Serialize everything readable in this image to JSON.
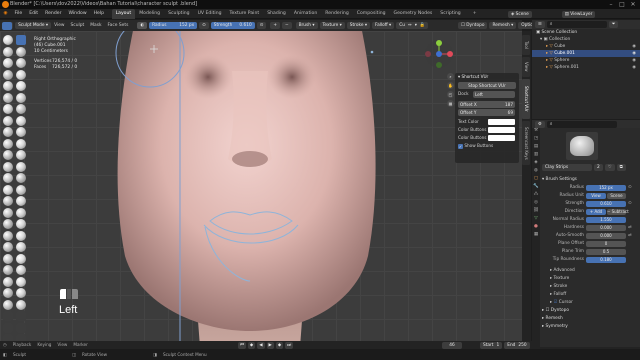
{
  "window": {
    "title": "Blender* [C:\\Users\\dov2022\\Videos\\Bahan Tutorial\\character sculpt .blend]",
    "controls": [
      "–",
      "□",
      "✕"
    ]
  },
  "menu": {
    "items": [
      "File",
      "Edit",
      "Render",
      "Window",
      "Help"
    ],
    "workspaces": [
      "Layout",
      "Modeling",
      "Sculpting",
      "UV Editing",
      "Texture Paint",
      "Shading",
      "Animation",
      "Rendering",
      "Compositing",
      "Geometry Nodes",
      "Scripting"
    ],
    "active_workspace": "Layout",
    "scene_label": "Scene",
    "view_layer_label": "ViewLayer"
  },
  "viewport_header": {
    "mode": "Sculpt Mode",
    "menus": [
      "View",
      "Sculpt",
      "Mask",
      "Face Sets"
    ],
    "radius_label": "Radius",
    "radius_value": "152 px",
    "strength_label": "Strength",
    "strength_value": "0.610",
    "right_menus": [
      "Brush",
      "Texture",
      "Stroke",
      "Falloff",
      "Cursor"
    ]
  },
  "viewport_info": {
    "view_name": "Right Orthographic",
    "object": "(46) Cube.001",
    "scale": "10 Centimeters",
    "vertices_label": "Vertices",
    "vertices_value": "726,574 / 0",
    "faces_label": "Faces",
    "faces_value": "726,572 / 0"
  },
  "viewport_header2": {
    "options": [
      "Dyntopo",
      "Remesh",
      "Options"
    ]
  },
  "screencast": {
    "label": "Left"
  },
  "npanel": {
    "title": "Shortcut VUr",
    "stop_button": "Stop Shortcut VUr",
    "dock_label": "Dock",
    "dock_value": "Left",
    "offset_x_label": "Offset X",
    "offset_x_value": "187",
    "offset_y_label": "Offset Y",
    "offset_y_value": "69",
    "text_color_label": "Text Color",
    "color_buttons_label": "Color Buttons",
    "color_buttons2_label": "Color Buttons",
    "show_buttons_label": "Show Buttons",
    "side_tabs": [
      "Tool",
      "View",
      "Shortcut VUr",
      "Screencast Keys"
    ]
  },
  "outliner": {
    "title": "Scene Collection",
    "rows": [
      {
        "label": "Collection",
        "selected": false
      },
      {
        "label": "Cube",
        "selected": false
      },
      {
        "label": "Cube.001",
        "selected": true
      },
      {
        "label": "Sphere",
        "selected": false
      },
      {
        "label": "Sphere.001",
        "selected": false
      }
    ]
  },
  "properties": {
    "brush_name": "Clay Strips",
    "brush_users": "2",
    "brush_settings": "Brush Settings",
    "radius_label": "Radius",
    "radius_value": "152 px",
    "radius_unit_label": "Radius Unit",
    "radius_unit_view": "View",
    "radius_unit_scene": "Scene",
    "strength_label": "Strength",
    "strength_value": "0.610",
    "direction_label": "Direction",
    "direction_add": "Add",
    "direction_subtract": "Subtract",
    "normal_radius_label": "Normal Radius",
    "normal_radius_value": "1.550",
    "hardness_label": "Hardness",
    "hardness_value": "0.000",
    "autosmooth_label": "Auto-Smooth",
    "autosmooth_value": "0.000",
    "plane_offset_label": "Plane Offset",
    "plane_offset_value": "0",
    "plane_trim_label": "Plane Trim",
    "plane_trim_value": "0.5",
    "tip_roundness_label": "Tip Roundness",
    "tip_roundness_value": "0.180",
    "sections": [
      "Advanced",
      "Texture",
      "Stroke",
      "Falloff",
      "Cursor"
    ],
    "sections2": [
      "Dyntopo",
      "Remesh",
      "Symmetry"
    ]
  },
  "status": {
    "left_items": [
      "Playback",
      "Keying",
      "View",
      "Marker"
    ],
    "frame": "46",
    "start_label": "Start",
    "start_value": "1",
    "end_label": "End",
    "end_value": "250",
    "bottom_items": [
      "Sculpt",
      "Rotate View",
      "Sculpt Context Menu"
    ]
  }
}
